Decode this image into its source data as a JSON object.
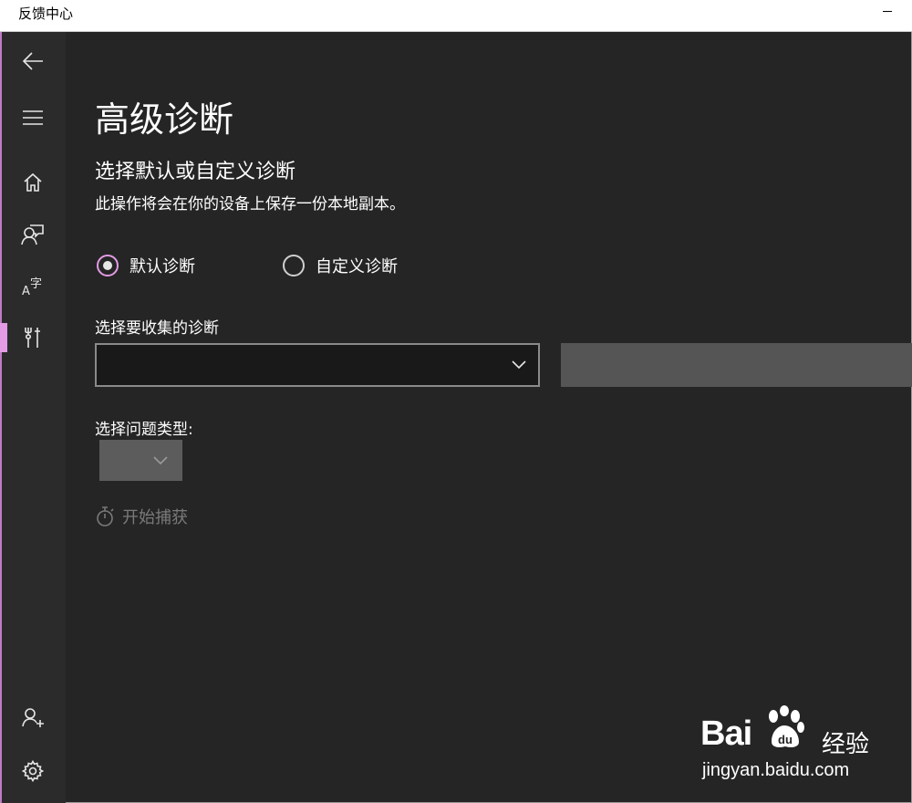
{
  "window": {
    "title": "反馈中心"
  },
  "sidebar": {
    "items": [
      {
        "name": "back",
        "icon": "back-arrow-icon"
      },
      {
        "name": "menu",
        "icon": "hamburger-icon"
      },
      {
        "name": "home",
        "icon": "home-icon"
      },
      {
        "name": "feedback",
        "icon": "person-feedback-icon"
      },
      {
        "name": "language",
        "icon": "language-icon"
      },
      {
        "name": "diagnostics",
        "icon": "tools-icon",
        "selected": true
      },
      {
        "name": "account",
        "icon": "person-add-icon"
      },
      {
        "name": "settings",
        "icon": "gear-icon"
      }
    ]
  },
  "main": {
    "title": "高级诊断",
    "subtitle": "选择默认或自定义诊断",
    "description": "此操作将会在你的设备上保存一份本地副本。",
    "radios": [
      {
        "label": "默认诊断",
        "checked": true
      },
      {
        "label": "自定义诊断",
        "checked": false
      }
    ],
    "collect_label": "选择要收集的诊断",
    "collect_value": "",
    "problem_type_label": "选择问题类型:",
    "capture_label": "开始捕获"
  },
  "watermark": {
    "brand_left": "Bai",
    "brand_right": "du",
    "brand_cn": "经验",
    "url": "jingyan.baidu.com"
  },
  "colors": {
    "accent": "#e39be6",
    "background": "#252525",
    "sidebar": "#2b2b2b"
  }
}
